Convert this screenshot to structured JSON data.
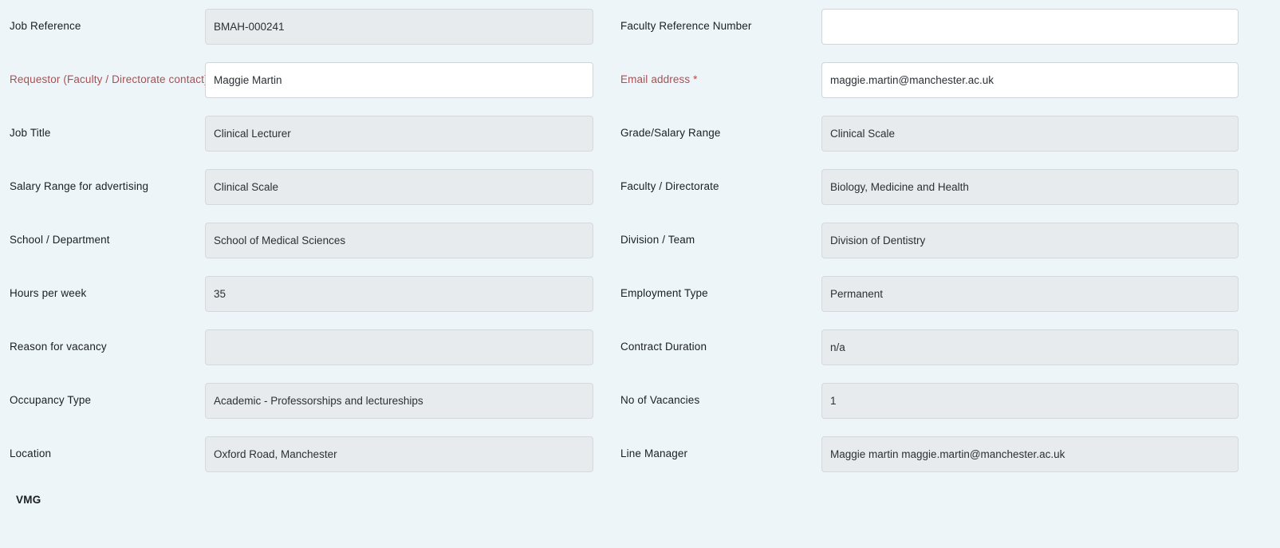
{
  "theme": {
    "page_background": "#eef5f8",
    "field_disabled_background": "#e8ebed",
    "field_editable_background": "#ffffff",
    "field_border": "#d3d9dd",
    "label_color": "#1b1f24",
    "required_label_color": "#ab4f52",
    "value_text_color": "#2b3035"
  },
  "form": {
    "rows": [
      {
        "left": {
          "label": "Job Reference",
          "value": "BMAH-000241",
          "required": false,
          "editable": false
        },
        "right": {
          "label": "Faculty Reference Number",
          "value": "",
          "required": false,
          "editable": true
        }
      },
      {
        "left": {
          "label": "Requestor (Faculty / Directorate contact) *",
          "value": "Maggie Martin",
          "required": true,
          "editable": true
        },
        "right": {
          "label": "Email address *",
          "value": "maggie.martin@manchester.ac.uk",
          "required": true,
          "editable": true
        }
      },
      {
        "left": {
          "label": "Job Title",
          "value": "Clinical Lecturer",
          "required": false,
          "editable": false
        },
        "right": {
          "label": "Grade/Salary Range",
          "value": "Clinical Scale",
          "required": false,
          "editable": false
        }
      },
      {
        "left": {
          "label": "Salary Range for advertising",
          "value": "Clinical Scale",
          "required": false,
          "editable": false
        },
        "right": {
          "label": "Faculty / Directorate",
          "value": "Biology, Medicine and Health",
          "required": false,
          "editable": false
        }
      },
      {
        "left": {
          "label": "School / Department",
          "value": "School of Medical Sciences",
          "required": false,
          "editable": false
        },
        "right": {
          "label": "Division / Team",
          "value": "Division of Dentistry",
          "required": false,
          "editable": false
        }
      },
      {
        "left": {
          "label": "Hours per week",
          "value": "35",
          "required": false,
          "editable": false
        },
        "right": {
          "label": "Employment Type",
          "value": "Permanent",
          "required": false,
          "editable": false
        }
      },
      {
        "left": {
          "label": "Reason for vacancy",
          "value": "",
          "required": false,
          "editable": false
        },
        "right": {
          "label": "Contract Duration",
          "value": "n/a",
          "required": false,
          "editable": false
        }
      },
      {
        "left": {
          "label": "Occupancy Type",
          "value": "Academic - Professorships and lectureships",
          "required": false,
          "editable": false
        },
        "right": {
          "label": "No of Vacancies",
          "value": "1",
          "required": false,
          "editable": false
        }
      },
      {
        "left": {
          "label": "Location",
          "value": "Oxford Road, Manchester",
          "required": false,
          "editable": false
        },
        "right": {
          "label": "Line Manager",
          "value": "Maggie martin  maggie.martin@manchester.ac.uk",
          "required": false,
          "editable": false
        }
      }
    ],
    "footer": {
      "label": "VMG"
    }
  }
}
